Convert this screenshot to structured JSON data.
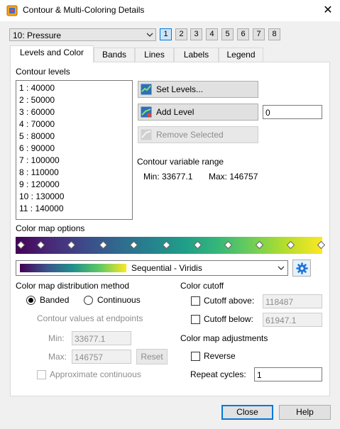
{
  "window": {
    "title": "Contour & Multi-Coloring Details",
    "close_glyph": "✕"
  },
  "zone": {
    "selected": "10: Pressure",
    "frames": [
      "1",
      "2",
      "3",
      "4",
      "5",
      "6",
      "7",
      "8"
    ],
    "active_frame": "1"
  },
  "tabs": [
    "Levels and Color",
    "Bands",
    "Lines",
    "Labels",
    "Legend"
  ],
  "levels": {
    "heading": "Contour levels",
    "items": [
      "1 : 40000",
      "2 : 50000",
      "3 : 60000",
      "4 : 70000",
      "5 : 80000",
      "6 : 90000",
      "7 : 100000",
      "8 : 110000",
      "9 : 120000",
      "10 : 130000",
      "11 : 140000"
    ],
    "set_levels": "Set Levels...",
    "add_level": "Add Level",
    "add_value": "0",
    "remove_selected": "Remove Selected"
  },
  "range": {
    "heading": "Contour variable range",
    "min": "Min:  33677.1",
    "max": "Max:  146757"
  },
  "colormap": {
    "heading": "Color map options",
    "name": "Sequential - Viridis",
    "gear_icon": "gear-icon",
    "accent": "#0078d7"
  },
  "distribution": {
    "heading": "Color map distribution method",
    "banded": "Banded",
    "continuous": "Continuous",
    "endpoints_heading": "Contour values at endpoints",
    "min_label": "Min:",
    "min_value": "33677.1",
    "max_label": "Max:",
    "max_value": "146757",
    "reset": "Reset",
    "approx": "Approximate continuous"
  },
  "cutoff": {
    "heading": "Color cutoff",
    "above_label": "Cutoff above:",
    "above_value": "118487",
    "below_label": "Cutoff below:",
    "below_value": "61947.1"
  },
  "adjust": {
    "heading": "Color map adjustments",
    "reverse": "Reverse",
    "repeat_label": "Repeat cycles:",
    "repeat_value": "1"
  },
  "footer": {
    "close": "Close",
    "help": "Help"
  }
}
